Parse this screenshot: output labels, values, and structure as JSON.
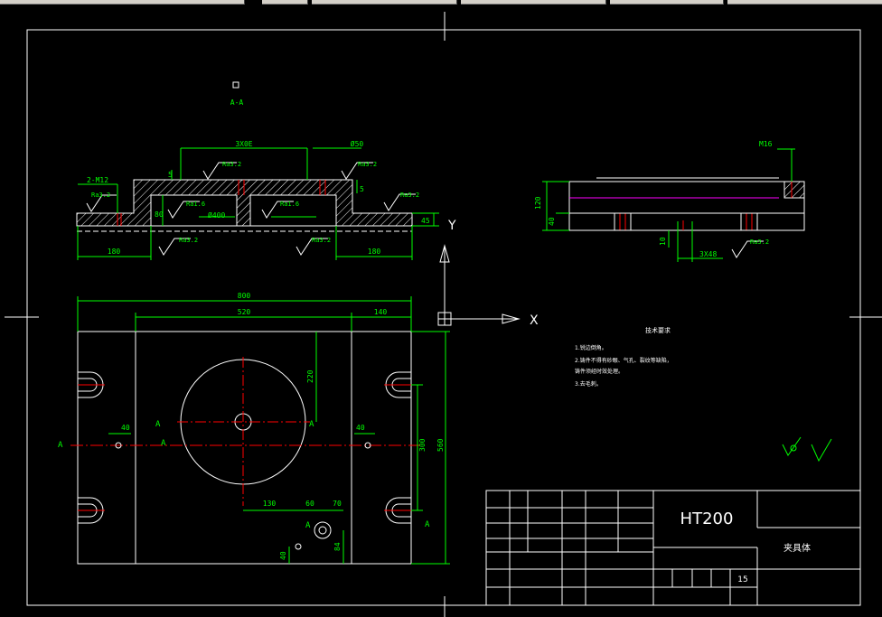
{
  "tabs": [
    "",
    "",
    "",
    "",
    "",
    ""
  ],
  "colors": {
    "background": "#000000",
    "outline": "#ffffff",
    "dimension": "#00ff00",
    "centerline": "#ff0000",
    "hidden": "#ff00ff"
  },
  "section_view": {
    "label_top": "A-A",
    "dims": {
      "d_width": "3X0E",
      "d_phi50": "Ø50",
      "d_2m12": "2-M12",
      "d_5a": "5",
      "d_5b": "5",
      "d_80": "80",
      "d_45": "45",
      "d_180a": "180",
      "d_180b": "180",
      "d_phi400": "Ø400"
    },
    "roughness": [
      "Ra3.2",
      "Ra3.2",
      "Ra3.2",
      "Ra3.2",
      "Ra3.2",
      "Ra3.2",
      "Ra3.2",
      "Ra1.6",
      "Ra1.6"
    ]
  },
  "side_view": {
    "dims": {
      "m16": "M16",
      "h120": "120",
      "h40": "40",
      "h10": "10",
      "w": "3X48"
    },
    "roughness": "Ra3.2"
  },
  "plan_view": {
    "dims": {
      "w800": "800",
      "w520": "520",
      "w140": "140",
      "h220": "220",
      "d40a": "40",
      "d40b": "40",
      "h300": "300",
      "h560": "560",
      "d130": "130",
      "d60": "60",
      "d70": "70",
      "d84": "84",
      "d40c": "40"
    },
    "section_marks": {
      "a_left": "A",
      "a_right": "A",
      "a_mid_left": "A",
      "a_mid_right": "A",
      "a_bottom": "A",
      "a_small": "A"
    }
  },
  "ucs": {
    "x": "X",
    "y": "Y"
  },
  "tech_notes": {
    "title": "技术要求",
    "lines": [
      "1.锐边倒角。",
      "2.铸件不得有砂眼、气孔、裂纹等缺陷，",
      "铸件须经时效处理。",
      "3.去毛刺。"
    ]
  },
  "title_block": {
    "material": "HT200",
    "part_name": "夹具体",
    "scale": "15"
  }
}
